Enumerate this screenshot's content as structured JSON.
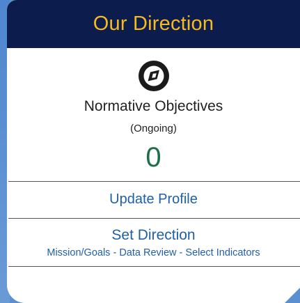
{
  "card": {
    "title": "Our Direction",
    "icon": "compass-icon",
    "label": "Normative Objectives",
    "status": "(Ongoing)",
    "count": "0"
  },
  "links": {
    "update_profile": "Update Profile",
    "set_direction": "Set Direction",
    "set_direction_sub": "Mission/Goals - Data Review - Select Indicators"
  },
  "colors": {
    "header_bg": "#0c1d4d",
    "title": "#f5b921",
    "count": "#1e6e47",
    "link": "#1f5fa8",
    "page_bg": "#5a8fd0"
  }
}
